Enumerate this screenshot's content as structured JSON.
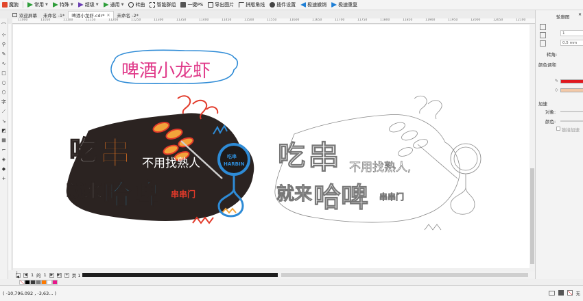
{
  "toolbar": {
    "app_label": "魔腕",
    "items": [
      {
        "label": "常用",
        "icon": "green-arrow-icon",
        "color": "#2e9e3a"
      },
      {
        "label": "特殊",
        "icon": "green-arrow-icon",
        "color": "#2e9e3a"
      },
      {
        "label": "超级",
        "icon": "purple-arrow-icon",
        "color": "#6b3fb3"
      },
      {
        "label": "通用",
        "icon": "green-arrow-icon",
        "color": "#2e9e3a"
      },
      {
        "label": "转曲",
        "icon": "curve-icon",
        "color": "#333333"
      },
      {
        "label": "智能群组",
        "icon": "group-icon",
        "color": "#333333"
      },
      {
        "label": "一键PS",
        "icon": "ps-icon",
        "color": "#333333"
      },
      {
        "label": "导出图片",
        "icon": "export-image-icon",
        "color": "#333333"
      },
      {
        "label": "拼版角线",
        "icon": "crop-mark-icon",
        "color": "#333333"
      },
      {
        "label": "插件设置",
        "icon": "gear-icon",
        "color": "#333333"
      },
      {
        "label": "极速撤销",
        "icon": "undo-icon",
        "color": "#1f7fd6"
      },
      {
        "label": "极速重复",
        "icon": "redo-icon",
        "color": "#1f7fd6"
      }
    ]
  },
  "tabs": [
    {
      "label": "欢迎屏幕",
      "active": false
    },
    {
      "label": "未命名 -1*",
      "active": false
    },
    {
      "label": "啤酒小龙虾.cdr*",
      "active": true
    },
    {
      "label": "未命名 -2*",
      "active": false
    }
  ],
  "ruler": {
    "ticks": [
      "11000",
      "11050",
      "11100",
      "11150",
      "11200",
      "11250",
      "11300",
      "11350",
      "11400",
      "11450",
      "11500",
      "11550",
      "11600",
      "11650",
      "11700",
      "11750",
      "11800",
      "11850",
      "11900",
      "11950",
      "12000",
      "12050",
      "12100"
    ]
  },
  "canvas": {
    "handwritten_title": "啤酒小龙虾",
    "art_left": {
      "word_eat": "吃",
      "word_skewer": "串",
      "line_no_friends": "不用找熟人",
      "word_come": "就来",
      "word_hapi": "哈啤",
      "word_chuanchuan": "串串门",
      "badge_top": "吃串",
      "badge_bottom": "HARBIN"
    },
    "art_right": {
      "word_eat": "吃",
      "word_skewer": "串",
      "line_no_friends": "不用找熟人,",
      "word_come": "就来",
      "word_hapi": "哈啤",
      "word_chuanchuan": "串串门"
    }
  },
  "pages": {
    "current": "1",
    "of_label": "的",
    "total": "1",
    "page_tab": "页 1"
  },
  "palette": [
    "#000000",
    "#3a3a3a",
    "#7a7a7a",
    "#ff7a00",
    "#ffffff",
    "#e8168b"
  ],
  "status": {
    "coords": "( -10,796.092 , -3,63... )",
    "fill_label": "无"
  },
  "right_panel": {
    "title": "轮廓图",
    "steps_value": "1",
    "offset_value": "0.5 mm",
    "corner_label": "转角:",
    "color_blend_label": "颜色调和",
    "accel_label": "加速",
    "object_label": "对象:",
    "color_label": "颜色:",
    "link_accel_label": "链接加速",
    "outline_color": "#e0181f",
    "fill_color": "#f3c9a8"
  }
}
